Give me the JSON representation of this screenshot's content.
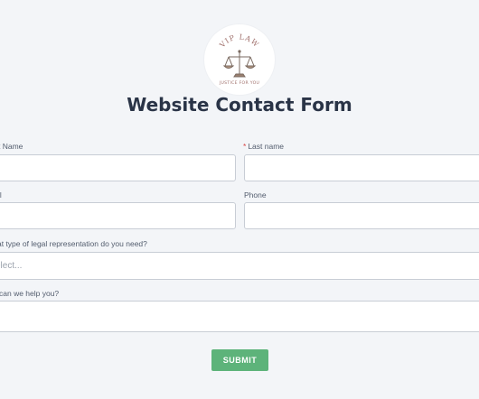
{
  "logo": {
    "top_text": "VIP LAW",
    "bottom_text": "JUSTICE FOR YOU",
    "icon": "scales-of-justice-icon",
    "text_color": "#a0706c"
  },
  "form": {
    "title": "Website Contact Form",
    "fields": {
      "first_name": {
        "label": "t Name",
        "value": ""
      },
      "last_name": {
        "required_mark": "*",
        "label": "Last name",
        "value": ""
      },
      "email": {
        "label": "il",
        "value": ""
      },
      "phone": {
        "label": "Phone",
        "value": ""
      },
      "representation": {
        "label": "at type of legal representation do you need?",
        "placeholder": "elect..."
      },
      "help": {
        "label": "can we help you?",
        "value": ""
      }
    },
    "submit_label": "SUBMIT",
    "accent_color": "#5db37a"
  }
}
